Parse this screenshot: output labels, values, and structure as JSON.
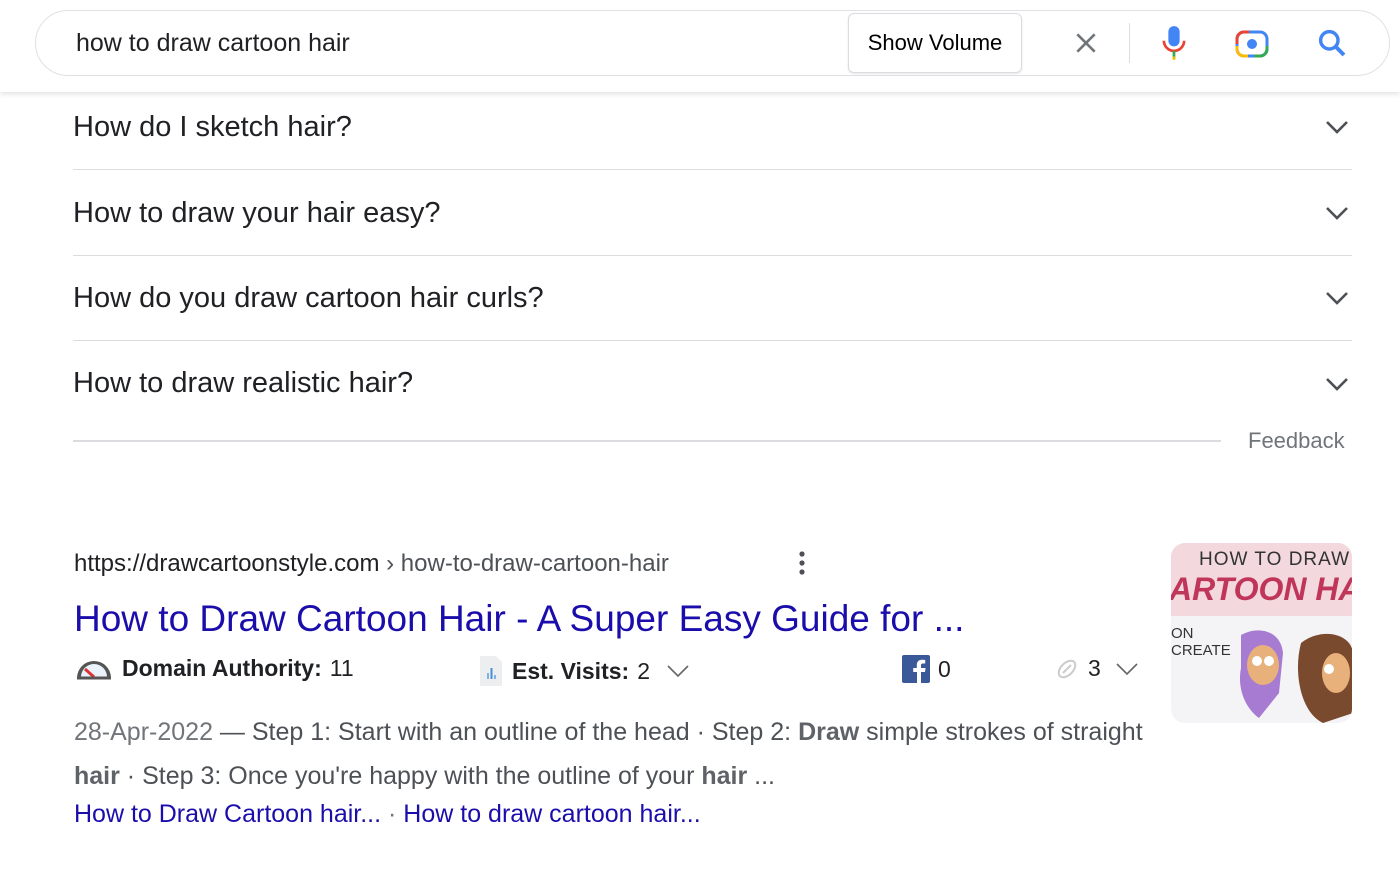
{
  "search": {
    "query": "how to draw cartoon hair",
    "show_volume": "Show Volume"
  },
  "faq": [
    {
      "question": "How do I sketch hair?"
    },
    {
      "question": "How to draw your hair easy?"
    },
    {
      "question": "How do you draw cartoon hair curls?"
    },
    {
      "question": "How to draw realistic hair?"
    }
  ],
  "feedback": "Feedback",
  "result": {
    "url_host": "https://drawcartoonstyle.com",
    "url_path": " › how-to-draw-cartoon-hair",
    "title": "How to Draw Cartoon Hair - A Super Easy Guide for ...",
    "domain_authority_label": "Domain Authority:",
    "domain_authority": "11",
    "visits_label": "Est. Visits:",
    "visits": "2",
    "facebook": "0",
    "links": "3",
    "date": "28-Apr-2022",
    "snippet_parts": [
      " — Step 1: Start with an outline of the head · Step 2: ",
      "Draw",
      " simple strokes of straight ",
      "hair",
      " · Step 3: Once you're happy with the outline of your ",
      "hair",
      " ..."
    ],
    "sitelinks": [
      "How to Draw Cartoon hair...",
      "How to draw cartoon hair..."
    ],
    "sitelink_sep": " · ",
    "thumbnail": {
      "line1": "HOW TO DRAW",
      "line2": "ARTOON HAI",
      "line3": "ON",
      "line4": "CREATE"
    }
  },
  "colors": {
    "link": "#1a0dab",
    "facebook": "#3b5998"
  }
}
